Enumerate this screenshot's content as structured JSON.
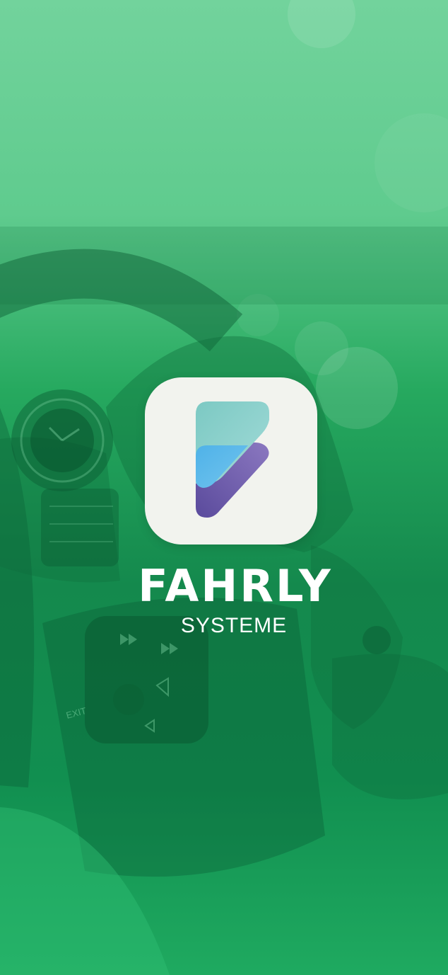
{
  "brand": {
    "name": "FAHRLY",
    "subtitle": "SYSTEME",
    "logo_icon": "fahrly-f-logo"
  },
  "background": {
    "icon": "car-steering-wheel-photo",
    "overlay_color": "#1faa60",
    "dashboard_labels": [
      "EXIT"
    ]
  },
  "colors": {
    "overlay_green": "#1faa60",
    "light_green": "#72d39c",
    "icon_background": "#f2f3ee",
    "logo_teal": "#8cd3cf",
    "logo_blue": "#5ab8e9",
    "logo_purple": "#6d5aa8"
  }
}
